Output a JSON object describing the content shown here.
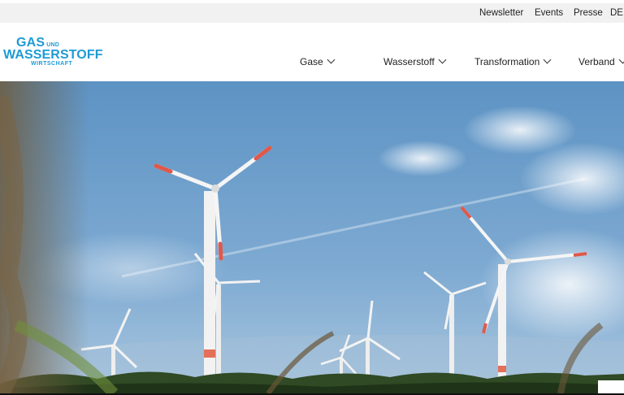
{
  "utility_nav": {
    "items": [
      "Newsletter",
      "Events",
      "Presse",
      "DE"
    ]
  },
  "logo": {
    "line1": "GAS",
    "line1_small": "UND",
    "line2": "WASSERSTOFF",
    "line3": "WIRTSCHAFT",
    "color": "#1e9ad6"
  },
  "main_nav": {
    "items": [
      {
        "label": "Gase",
        "icon": "chevron-down-icon"
      },
      {
        "label": "Wasserstoff",
        "icon": "chevron-down-icon"
      },
      {
        "label": "Transformation",
        "icon": "chevron-down-icon"
      },
      {
        "label": "Verband",
        "icon": "chevron-down-icon"
      }
    ]
  },
  "hero": {
    "image": "wind-turbines-field-photo",
    "sky_color": "#6f9fc9"
  }
}
